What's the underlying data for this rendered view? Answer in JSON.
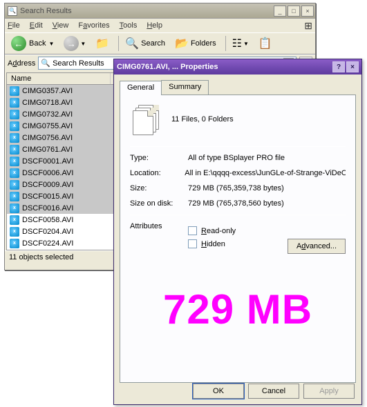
{
  "explorer": {
    "title": "Search Results",
    "menu": [
      "File",
      "Edit",
      "View",
      "Favorites",
      "Tools",
      "Help"
    ],
    "toolbar": {
      "back": "Back",
      "search": "Search",
      "folders": "Folders"
    },
    "address_label": "Address",
    "address_value": "Search Results",
    "columns": [
      "Name"
    ],
    "files": [
      "CIMG0357.AVI",
      "CIMG0718.AVI",
      "CIMG0732.AVI",
      "CIMG0755.AVI",
      "CIMG0756.AVI",
      "CIMG0761.AVI",
      "DSCF0001.AVI",
      "DSCF0006.AVI",
      "DSCF0009.AVI",
      "DSCF0015.AVI",
      "DSCF0016.AVI",
      "DSCF0058.AVI",
      "DSCF0204.AVI",
      "DSCF0224.AVI"
    ],
    "status": "11 objects selected"
  },
  "props": {
    "title": "CIMG0761.AVI, ... Properties",
    "tabs": [
      "General",
      "Summary"
    ],
    "summary": "11 Files, 0 Folders",
    "type_k": "Type:",
    "type_v": "All of type BSplayer PRO file",
    "loc_k": "Location:",
    "loc_v": "All in E:\\qqqq-excess\\JunGLe-of-Strange-ViDeO-C",
    "size_k": "Size:",
    "size_v": "729 MB (765,359,738 bytes)",
    "disk_k": "Size on disk:",
    "disk_v": "729 MB (765,378,560 bytes)",
    "attr_k": "Attributes",
    "readonly": "Read-only",
    "hidden": "Hidden",
    "advanced": "Advanced...",
    "big": "729 MB",
    "ok": "OK",
    "cancel": "Cancel",
    "apply": "Apply"
  }
}
